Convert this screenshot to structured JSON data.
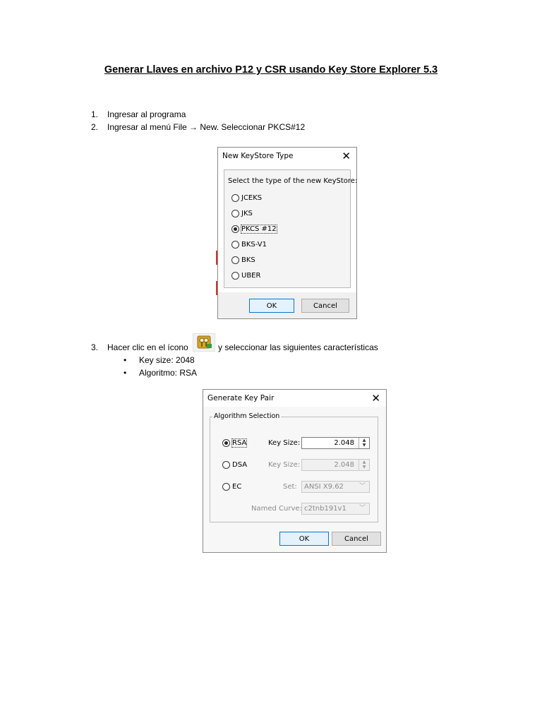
{
  "document": {
    "title": "Generar Llaves en archivo P12 y CSR usando Key Store Explorer 5.3",
    "steps": [
      {
        "num": "1.",
        "text": "Ingresar al programa"
      },
      {
        "num": "2.",
        "text": "Ingresar al menú File → New. Seleccionar PKCS#12"
      },
      {
        "num": "3.",
        "text_before": "Hacer clic en el ícono",
        "text_after": "y seleccionar las siguientes características"
      }
    ],
    "bullets": [
      "Key size: 2048",
      "Algoritmo: RSA"
    ],
    "bullet_glyph": "•"
  },
  "keystore_dialog": {
    "title": "New KeyStore Type",
    "close": "✕",
    "prompt": "Select the type of the new KeyStore:",
    "options": [
      "JCEKS",
      "JKS",
      "PKCS #12",
      "BKS-V1",
      "BKS",
      "UBER"
    ],
    "selected": "PKCS #12",
    "ok": "OK",
    "cancel": "Cancel"
  },
  "keypair_dialog": {
    "title": "Generate Key Pair",
    "close": "✕",
    "group_label": "Algorithm Selection",
    "rsa_label": "RSA",
    "dsa_label": "DSA",
    "ec_label": "EC",
    "selected": "RSA",
    "rsa_keysize_label": "Key Size:",
    "rsa_keysize_value": "2.048",
    "dsa_keysize_label": "Key Size:",
    "dsa_keysize_value": "2.048",
    "set_label": "Set:",
    "set_value": "ANSI X9.62",
    "curve_label": "Named Curve:",
    "curve_value": "c2tnb191v1",
    "ok": "OK",
    "cancel": "Cancel"
  },
  "icons": {
    "generate_keypair_icon": "key-pair-icon",
    "spin_icon": "spinner-arrows-icon",
    "dropdown_icon": "chevron-down-icon"
  }
}
